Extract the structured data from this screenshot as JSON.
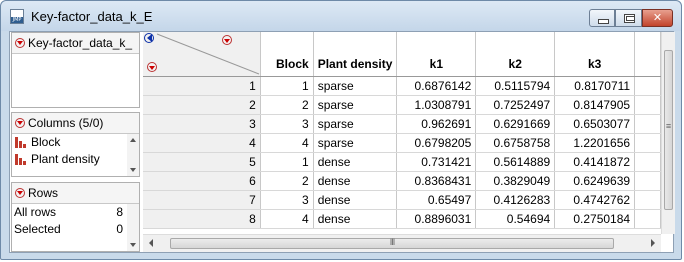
{
  "window": {
    "title": "Key-factor_data_k_E",
    "icon": "jmp-data-table-icon",
    "icon_tag": "JMP"
  },
  "controls": {
    "minimize": "minimize-icon",
    "maximize": "maximize-icon",
    "close": "close-icon"
  },
  "left_panel": {
    "table_name": "Key-factor_data_k_",
    "columns_header": "Columns (5/0)",
    "columns": [
      {
        "name": "Block",
        "icon": "continuous-bars-icon"
      },
      {
        "name": "Plant density",
        "icon": "continuous-bars-icon"
      }
    ],
    "rows_header": "Rows",
    "rows_stats": [
      {
        "label": "All rows",
        "value": "8"
      },
      {
        "label": "Selected",
        "value": "0"
      }
    ]
  },
  "grid": {
    "headers": [
      "Block",
      "Plant density",
      "k1",
      "k2",
      "k3"
    ],
    "rows": [
      {
        "n": "1",
        "block": "1",
        "density": "sparse",
        "k1": "0.6876142",
        "k2": "0.5115794",
        "k3": "0.8170711"
      },
      {
        "n": "2",
        "block": "2",
        "density": "sparse",
        "k1": "1.0308791",
        "k2": "0.7252497",
        "k3": "0.8147905"
      },
      {
        "n": "3",
        "block": "3",
        "density": "sparse",
        "k1": "0.962691",
        "k2": "0.6291669",
        "k3": "0.6503077"
      },
      {
        "n": "4",
        "block": "4",
        "density": "sparse",
        "k1": "0.6798205",
        "k2": "0.6758758",
        "k3": "1.2201656"
      },
      {
        "n": "5",
        "block": "1",
        "density": "dense",
        "k1": "0.731421",
        "k2": "0.5614889",
        "k3": "0.4141872"
      },
      {
        "n": "6",
        "block": "2",
        "density": "dense",
        "k1": "0.8368431",
        "k2": "0.3829049",
        "k3": "0.6249639"
      },
      {
        "n": "7",
        "block": "3",
        "density": "dense",
        "k1": "0.65497",
        "k2": "0.4126283",
        "k3": "0.4742762"
      },
      {
        "n": "8",
        "block": "4",
        "density": "dense",
        "k1": "0.8896031",
        "k2": "0.54694",
        "k3": "0.2750184"
      }
    ]
  },
  "scrollbars": {
    "h_grip": "III",
    "v_grip": "≡"
  }
}
